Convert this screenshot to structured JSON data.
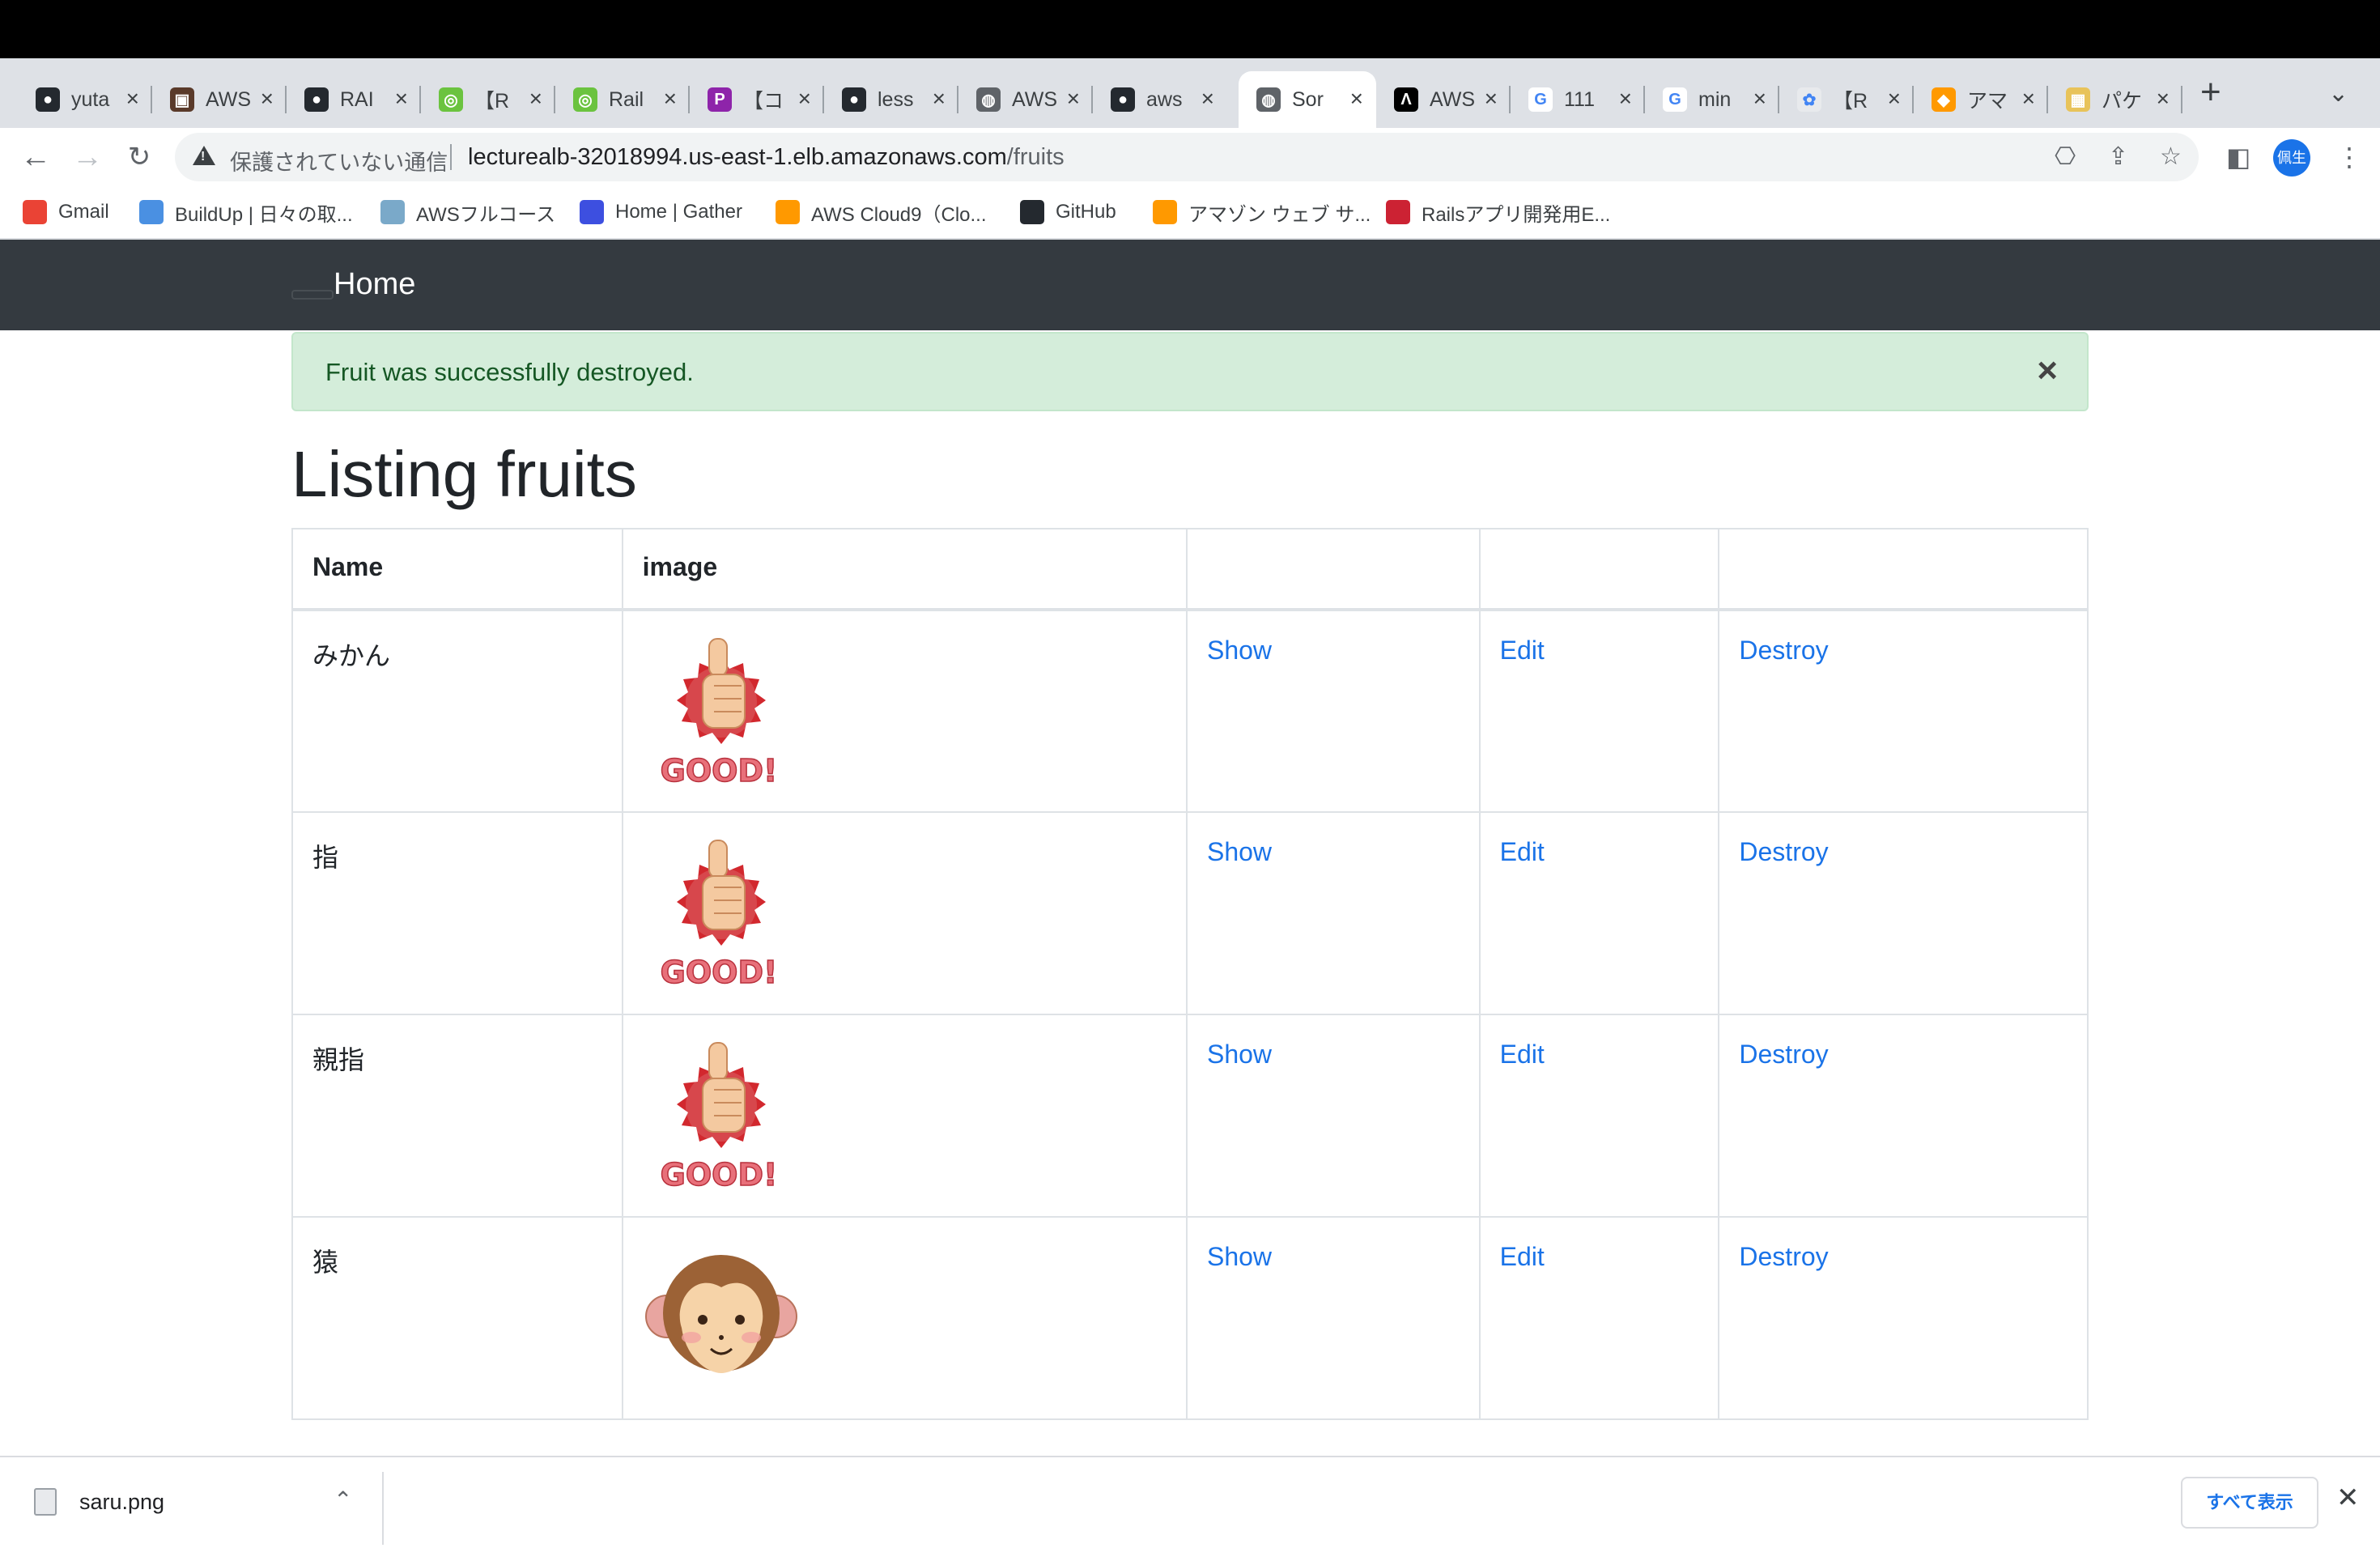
{
  "browser": {
    "tabs": [
      {
        "title": "yuta",
        "fav_color": "#24292f",
        "fav_glyph": "●"
      },
      {
        "title": "AWS",
        "fav_color": "#5a3a2a",
        "fav_glyph": "▣"
      },
      {
        "title": "RAI",
        "fav_color": "#24292f",
        "fav_glyph": "●"
      },
      {
        "title": "【R",
        "fav_color": "#6bc33f",
        "fav_glyph": "◎"
      },
      {
        "title": "Rail",
        "fav_color": "#6bc33f",
        "fav_glyph": "◎"
      },
      {
        "title": "【コ",
        "fav_color": "#8e24aa",
        "fav_glyph": "P"
      },
      {
        "title": "less",
        "fav_color": "#24292f",
        "fav_glyph": "●"
      },
      {
        "title": "AWS",
        "fav_color": "#5f6368",
        "fav_glyph": "◍"
      },
      {
        "title": "aws",
        "fav_color": "#24292f",
        "fav_glyph": "●"
      },
      {
        "title": "Sor",
        "fav_color": "#5f6368",
        "fav_glyph": "◍"
      },
      {
        "title": "AWS",
        "fav_color": "#000000",
        "fav_glyph": "Λ"
      },
      {
        "title": "111",
        "fav_color": "#ffffff",
        "fav_glyph": "G"
      },
      {
        "title": "min",
        "fav_color": "#ffffff",
        "fav_glyph": "G"
      },
      {
        "title": "【R",
        "fav_color": "#e8eaed",
        "fav_glyph": "✿"
      },
      {
        "title": "アマ",
        "fav_color": "#ff9900",
        "fav_glyph": "◆"
      },
      {
        "title": "パケ",
        "fav_color": "#e8c35a",
        "fav_glyph": "▦"
      }
    ],
    "active_tab_index": 9,
    "insecure_label": "保護されていない通信",
    "url_host": "lecturealb-32018994.us-east-1.elb.amazonaws.com",
    "url_path": "/fruits",
    "profile_label": "佩生",
    "bookmarks": [
      {
        "label": "Gmail",
        "color": "#ea4335"
      },
      {
        "label": "BuildUp | 日々の取...",
        "color": "#4a90e2"
      },
      {
        "label": "AWSフルコース",
        "color": "#7aa9c9"
      },
      {
        "label": "Home | Gather",
        "color": "#3d4fe0"
      },
      {
        "label": "AWS Cloud9（Clo...",
        "color": "#ff9900"
      },
      {
        "label": "GitHub",
        "color": "#24292f"
      },
      {
        "label": "アマゾン ウェブ サ...",
        "color": "#ff9900"
      },
      {
        "label": "Railsアプリ開発用E...",
        "color": "#cc2233"
      }
    ]
  },
  "navbar": {
    "home_label": "Home"
  },
  "alert": {
    "message": "Fruit was successfully destroyed.",
    "close_glyph": "×"
  },
  "page": {
    "title": "Listing fruits"
  },
  "table": {
    "headers": [
      "Name",
      "image",
      "",
      "",
      ""
    ],
    "rows": [
      {
        "name": "みかん",
        "image": "good-thumb",
        "show": "Show",
        "edit": "Edit",
        "destroy": "Destroy"
      },
      {
        "name": "指",
        "image": "good-thumb",
        "show": "Show",
        "edit": "Edit",
        "destroy": "Destroy"
      },
      {
        "name": "親指",
        "image": "good-thumb",
        "show": "Show",
        "edit": "Edit",
        "destroy": "Destroy"
      },
      {
        "name": "猿",
        "image": "monkey-face",
        "show": "Show",
        "edit": "Edit",
        "destroy": "Destroy"
      }
    ]
  },
  "downloads": {
    "file_name": "saru.png",
    "show_all_label": "すべて表示"
  },
  "colors": {
    "link": "#1a73e8",
    "navbar": "#343a40",
    "alert_bg": "#d4edda",
    "alert_text": "#155724"
  }
}
